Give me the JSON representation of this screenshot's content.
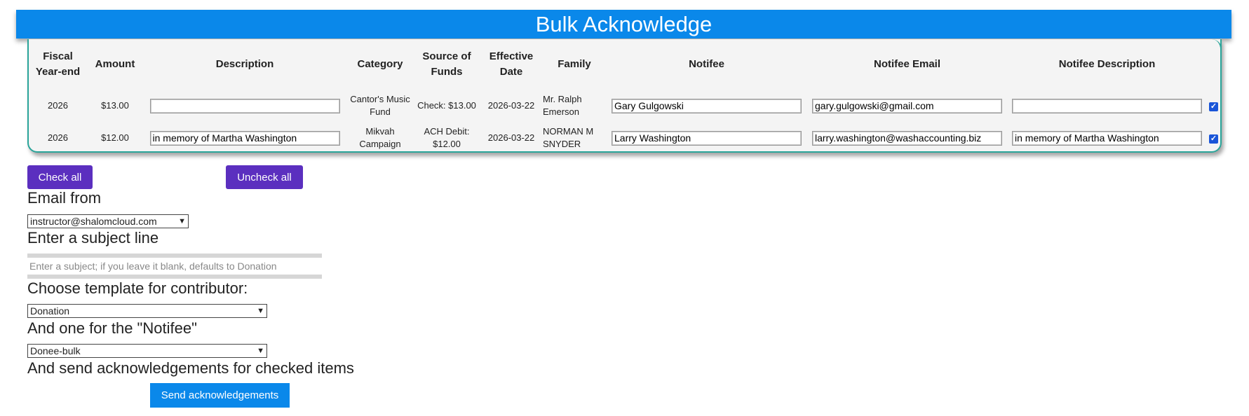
{
  "page": {
    "title": "Bulk Acknowledge"
  },
  "table": {
    "headers": [
      "Fiscal Year-end",
      "Amount",
      "Description",
      "Category",
      "Source of Funds",
      "Effective Date",
      "Family",
      "Notifee",
      "Notifee Email",
      "Notifee Description"
    ],
    "rows": [
      {
        "fiscal_year_end": "2026",
        "amount": "$13.00",
        "description": "",
        "category": "Cantor's Music Fund",
        "source_of_funds": "Check: $13.00",
        "effective_date": "2026-03-22",
        "family": "Mr. Ralph Emerson",
        "notifee": "Gary Gulgowski",
        "notifee_email": "gary.gulgowski@gmail.com",
        "notifee_description": "",
        "checked": true
      },
      {
        "fiscal_year_end": "2026",
        "amount": "$12.00",
        "description": "in memory of Martha Washington",
        "category": "Mikvah Campaign",
        "source_of_funds": "ACH Debit: $12.00",
        "effective_date": "2026-03-22",
        "family": "NORMAN M SNYDER",
        "notifee": "Larry Washington",
        "notifee_email": "larry.washington@washaccounting.biz",
        "notifee_description": "in memory of Martha Washington",
        "checked": true
      }
    ]
  },
  "buttons": {
    "check_all": "Check all",
    "uncheck_all": "Uncheck all",
    "send": "Send acknowledgements"
  },
  "form": {
    "email_from_label": "Email from",
    "email_from_value": "instructor@shalomcloud.com",
    "subject_label": "Enter a subject line",
    "subject_placeholder": "Enter a subject; if you leave it blank, defaults to Donation",
    "subject_value": "",
    "contributor_template_label": "Choose template for contributor:",
    "contributor_template_value": "Donation",
    "notifee_template_label": "And one for the \"Notifee\"",
    "notifee_template_value": "Donee-bulk",
    "send_label": "And send acknowledgements for checked items"
  },
  "colors": {
    "title_bar": "#0a88ea",
    "primary_button": "#5b2fbf",
    "send_button": "#0a88ea",
    "table_border": "#2aa59a"
  }
}
